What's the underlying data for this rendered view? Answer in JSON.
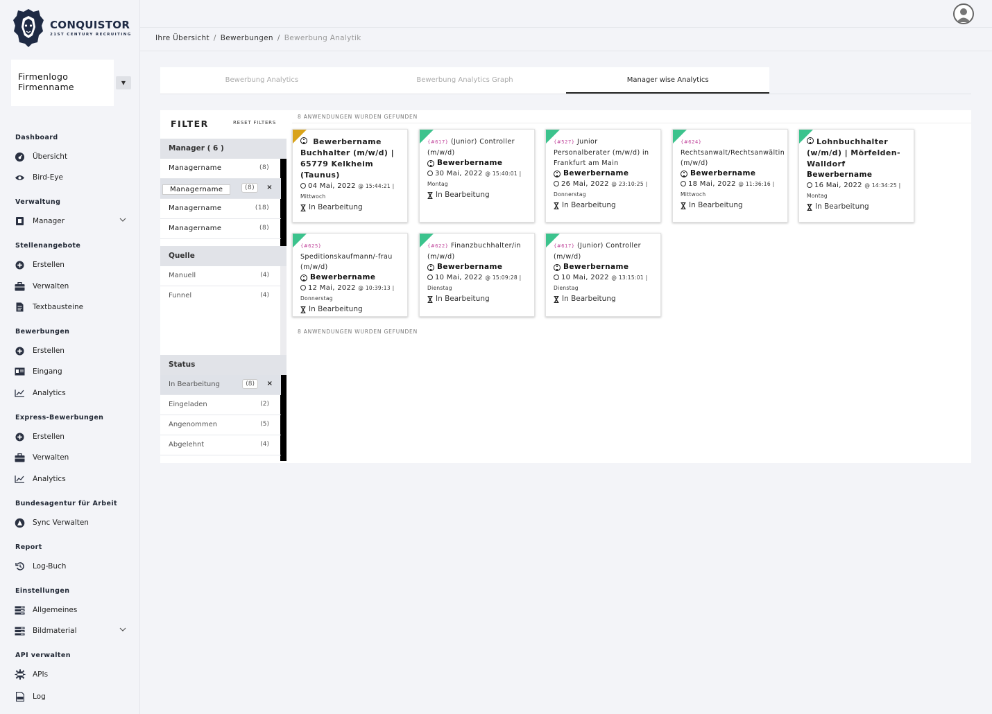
{
  "brand": {
    "title": "CONQUISTOR",
    "subtitle": "21ST CENTURY RECRUITING"
  },
  "company": {
    "line1": "Firmenlogo",
    "line2": "Firmenname"
  },
  "sidebar": {
    "sections": [
      {
        "heading": "Dashboard",
        "items": [
          "Übersicht",
          "Bird-Eye"
        ]
      },
      {
        "heading": "Verwaltung",
        "items": [
          "Manager"
        ]
      },
      {
        "heading": "Stellenangebote",
        "items": [
          "Erstellen",
          "Verwalten",
          "Textbausteine"
        ]
      },
      {
        "heading": "Bewerbungen",
        "items": [
          "Erstellen",
          "Eingang",
          "Analytics"
        ]
      },
      {
        "heading": "Express-Bewerbungen",
        "items": [
          "Erstellen",
          "Verwalten",
          "Analytics"
        ]
      },
      {
        "heading": "Bundesagentur für Arbeit",
        "items": [
          "Sync Verwalten"
        ]
      },
      {
        "heading": "Report",
        "items": [
          "Log-Buch"
        ]
      },
      {
        "heading": "Einstellungen",
        "items": [
          "Allgemeines",
          "Bildmaterial"
        ]
      },
      {
        "heading": "API verwalten",
        "items": [
          "APIs",
          "Log"
        ]
      }
    ]
  },
  "breadcrumb": [
    "Ihre Übersicht",
    "/",
    "Bewerbungen",
    "/",
    "Bewerbung Analytik"
  ],
  "tabs": [
    "Bewerbung Analytics",
    "Bewerbung Analytics Graph",
    "Manager wise Analytics"
  ],
  "filter": {
    "title": "FILTER",
    "reset": "RESET FILTERS",
    "manager_group": "Manager ( 6 )",
    "managers": [
      {
        "name": "Managername",
        "count": "(8)"
      },
      {
        "name": "Managername",
        "count": "(8)"
      },
      {
        "name": "Managername",
        "count": "(18)"
      },
      {
        "name": "Managername",
        "count": "(8)"
      }
    ],
    "source_group": "Quelle",
    "sources": [
      {
        "name": "Manuell",
        "count": "(4)"
      },
      {
        "name": "Funnel",
        "count": "(4)"
      }
    ],
    "status_group": "Status",
    "statuses": [
      {
        "name": "In Bearbeitung",
        "count": "(8)"
      },
      {
        "name": "Eingeladen",
        "count": "(2)"
      },
      {
        "name": "Angenommen",
        "count": "(5)"
      },
      {
        "name": "Abgelehnt",
        "count": "(4)"
      }
    ],
    "close": "×"
  },
  "results": {
    "found_label": "8 ANWENDUNGEN WURDEN GEFUNDEN"
  },
  "cards": [
    {
      "num": "",
      "title": "",
      "name": "Bewerbername Buchhalter (m/w/d) | 65779 Kelkheim (Taunus)",
      "date": "04 Mai, 2022",
      "time": "@ 15:44:21 | Mittwoch",
      "status": "In Bearbeitung",
      "color": "#d9a31a"
    },
    {
      "num": "{#617}",
      "title": "(Junior) Controller (m/w/d)",
      "name": "Bewerbername",
      "date": "30 Mai, 2022",
      "time": "@ 15:40:01 | Montag",
      "status": "In Bearbeitung",
      "color": "#3cc38d"
    },
    {
      "num": "{#527}",
      "title": "Junior Personalberater (m/w/d) in Frankfurt am Main",
      "name": "Bewerbername",
      "date": "26 Mai, 2022",
      "time": "@ 23:10:25 | Donnerstag",
      "status": "In Bearbeitung",
      "color": "#3cc38d"
    },
    {
      "num": "{#624}",
      "title": "Rechtsanwalt/Rechtsanwältin (m/w/d)",
      "name": "Bewerbername",
      "date": "18 Mai, 2022",
      "time": "@ 11:36:16 | Mittwoch",
      "status": "In Bearbeitung",
      "color": "#3cc38d"
    },
    {
      "num": "",
      "title": "",
      "name": "Lohnbuchhalter (w/m/d) | Mörfelden-Walldorf",
      "name2": "Bewerbername",
      "date": "16 Mai, 2022",
      "time": "@ 14:34:25 | Montag",
      "status": "In Bearbeitung",
      "color": "#3cc38d"
    },
    {
      "num": "{#625}",
      "title": "Speditionskaufmann/-frau (m/w/d)",
      "name": "Bewerbername",
      "date": "12 Mai, 2022",
      "time": "@ 10:39:13 | Donnerstag",
      "status": "In Bearbeitung",
      "color": "#3cc38d"
    },
    {
      "num": "{#622}",
      "title": "Finanzbuchhalter/in (m/w/d)",
      "name": "Bewerbername",
      "date": "10 Mai, 2022",
      "time": "@ 15:09:28 | Dienstag",
      "status": "In Bearbeitung",
      "color": "#3cc38d"
    },
    {
      "num": "{#617}",
      "title": "(Junior) Controller (m/w/d)",
      "name": "Bewerbername",
      "date": "10 Mai, 2022",
      "time": "@ 13:15:01 | Dienstag",
      "status": "In Bearbeitung",
      "color": "#3cc38d"
    }
  ]
}
